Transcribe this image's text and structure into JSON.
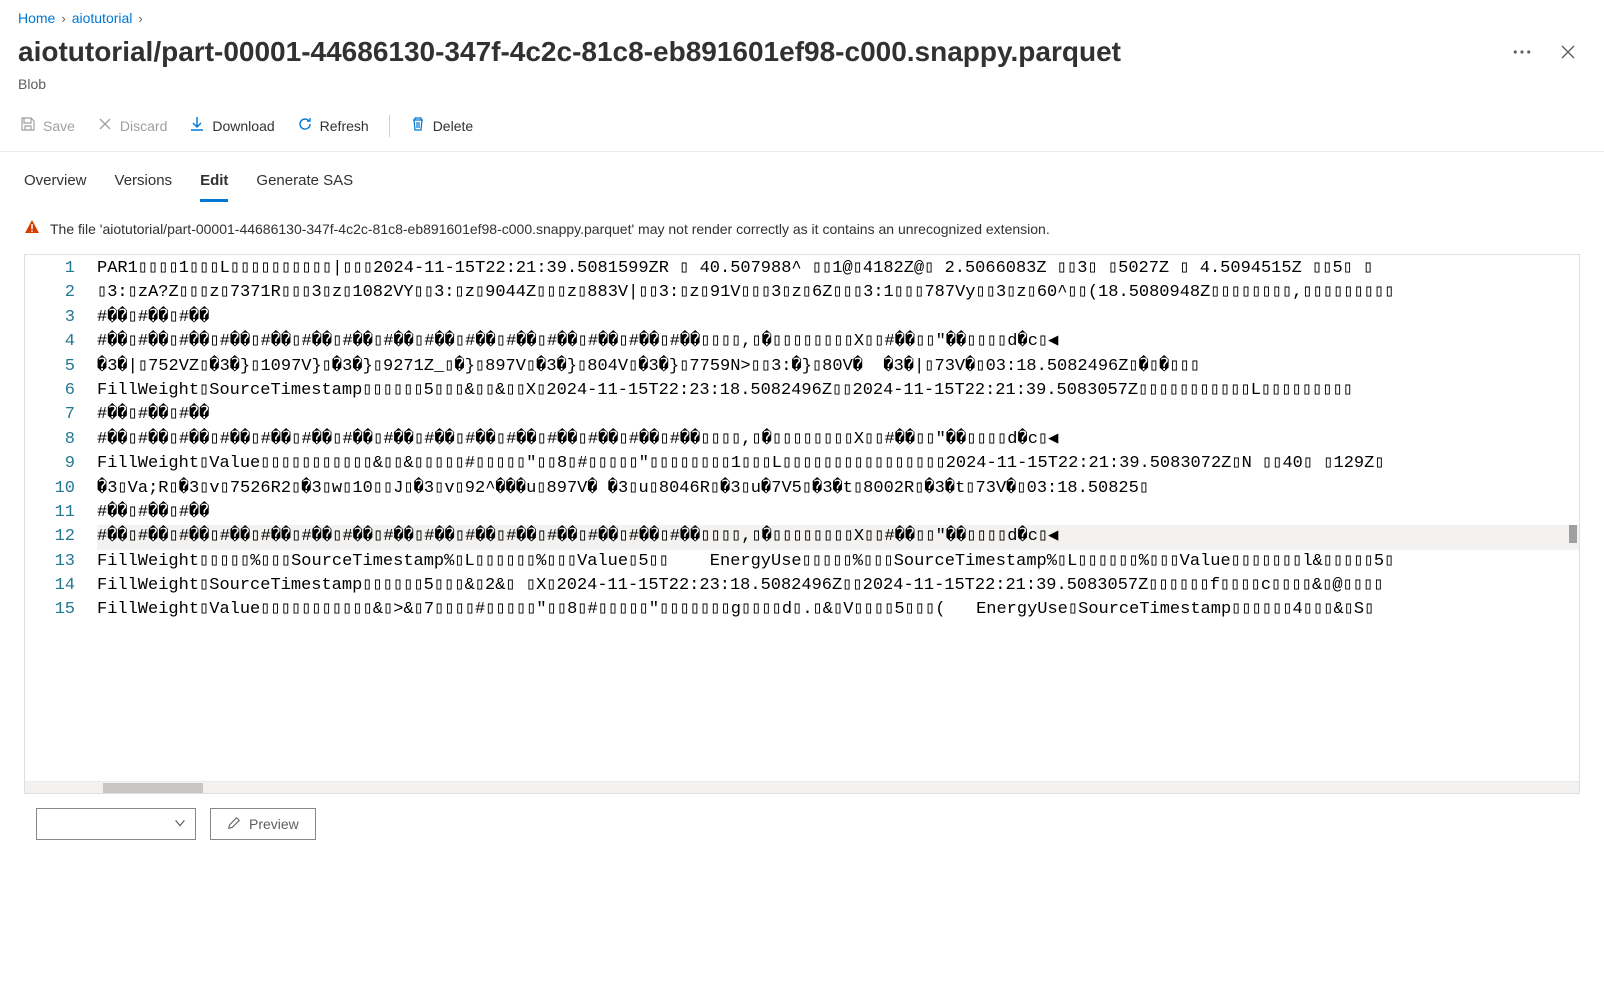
{
  "breadcrumb": {
    "items": [
      {
        "label": "Home"
      },
      {
        "label": "aiotutorial"
      }
    ]
  },
  "page": {
    "title": "aiotutorial/part-00001-44686130-347f-4c2c-81c8-eb891601ef98-c000.snappy.parquet",
    "subtitle": "Blob"
  },
  "toolbar": {
    "save": "Save",
    "discard": "Discard",
    "download": "Download",
    "refresh": "Refresh",
    "delete": "Delete"
  },
  "tabs": {
    "overview": "Overview",
    "versions": "Versions",
    "edit": "Edit",
    "generate_sas": "Generate SAS"
  },
  "warning": {
    "text": "The file 'aiotutorial/part-00001-44686130-347f-4c2c-81c8-eb891601ef98-c000.snappy.parquet' may not render correctly as it contains an unrecognized extension."
  },
  "editor": {
    "lines": [
      "PAR1▯▯▯▯1▯▯▯L▯▯▯▯▯▯▯▯▯▯|▯▯▯2024-11-15T22:21:39.5081599ZR ▯ 40.507988^ ▯▯1@▯4182Z@▯ 2.5066083Z ▯▯3▯ ▯5027Z ▯ 4.5094515Z ▯▯5▯ ▯",
      "▯3:▯zA?Z▯▯▯z▯7371R▯▯▯3▯z▯1082VY▯▯3:▯z▯9044Z▯▯▯z▯883V|▯▯3:▯z▯91V▯▯▯3▯z▯6Z▯▯▯3:1▯▯▯787Vy▯▯3▯z▯60^▯▯(18.5080948Z▯▯▯▯▯▯▯▯,▯▯▯▯▯▯▯▯▯",
      "#��▯#��▯#��",
      "#��▯#��▯#��▯#��▯#��▯#��▯#��▯#��▯#��▯#��▯#��▯#��▯#��▯#��▯#��▯▯▯▯,▯�▯▯▯▯▯▯▯▯X▯▯#��▯▯\"��▯▯▯▯d�c▯◀",
      "�3�|▯752VZ▯�3�}▯1097V}▯�3�}▯9271Z_▯�}▯897V▯�3�}▯804V▯�3�}▯7759N>▯▯3:�}▯80V�  �3�|▯73V�▯03:18.5082496Z▯�▯�▯▯▯",
      "FillWeight▯SourceTimestamp▯▯▯▯▯▯5▯▯▯&▯▯&▯▯X▯2024-11-15T22:23:18.5082496Z▯▯2024-11-15T22:21:39.5083057Z▯▯▯▯▯▯▯▯▯▯▯L▯▯▯▯▯▯▯▯▯",
      "#��▯#��▯#��",
      "#��▯#��▯#��▯#��▯#��▯#��▯#��▯#��▯#��▯#��▯#��▯#��▯#��▯#��▯#��▯▯▯▯,▯�▯▯▯▯▯▯▯▯X▯▯#��▯▯\"��▯▯▯▯d�c▯◀",
      "FillWeight▯Value▯▯▯▯▯▯▯▯▯▯▯&▯▯&▯▯▯▯▯#▯▯▯▯▯\"▯▯8▯#▯▯▯▯▯\"▯▯▯▯▯▯▯▯1▯▯▯L▯▯▯▯▯▯▯▯▯▯▯▯▯▯▯▯2024-11-15T22:21:39.5083072Z▯N ▯▯40▯ ▯129Z▯",
      "�3▯Va;R▯�3▯v▯7526R2▯�3▯w▯10▯▯J▯�3▯v▯92^���u▯897V� �3▯u▯8046R▯�3▯u�7V5▯�3�t▯8002R▯�3�t▯73V�▯03:18.50825▯",
      "#��▯#��▯#��",
      "#��▯#��▯#��▯#��▯#��▯#��▯#��▯#��▯#��▯#��▯#��▯#��▯#��▯#��▯#��▯▯▯▯,▯�▯▯▯▯▯▯▯▯X▯▯#��▯▯\"��▯▯▯▯d�c▯◀",
      "FillWeight▯▯▯▯▯%▯▯▯SourceTimestamp%▯L▯▯▯▯▯▯%▯▯▯Value▯5▯▯    EnergyUse▯▯▯▯▯%▯▯▯SourceTimestamp%▯L▯▯▯▯▯▯%▯▯▯Value▯▯▯▯▯▯▯l&▯▯▯▯▯5▯",
      "FillWeight▯SourceTimestamp▯▯▯▯▯▯5▯▯▯&▯2&▯ ▯X▯2024-11-15T22:23:18.5082496Z▯▯2024-11-15T22:21:39.5083057Z▯▯▯▯▯▯f▯▯▯▯c▯▯▯▯&▯@▯▯▯▯",
      "FillWeight▯Value▯▯▯▯▯▯▯▯▯▯▯&▯>&▯7▯▯▯▯#▯▯▯▯▯\"▯▯8▯#▯▯▯▯▯\"▯▯▯▯▯▯▯g▯▯▯▯d▯.▯&▯V▯▯▯▯5▯▯▯(   EnergyUse▯SourceTimestamp▯▯▯▯▯▯4▯▯▯&▯S▯"
    ],
    "highlighted_line_index": 11
  },
  "footer": {
    "preview": "Preview"
  }
}
